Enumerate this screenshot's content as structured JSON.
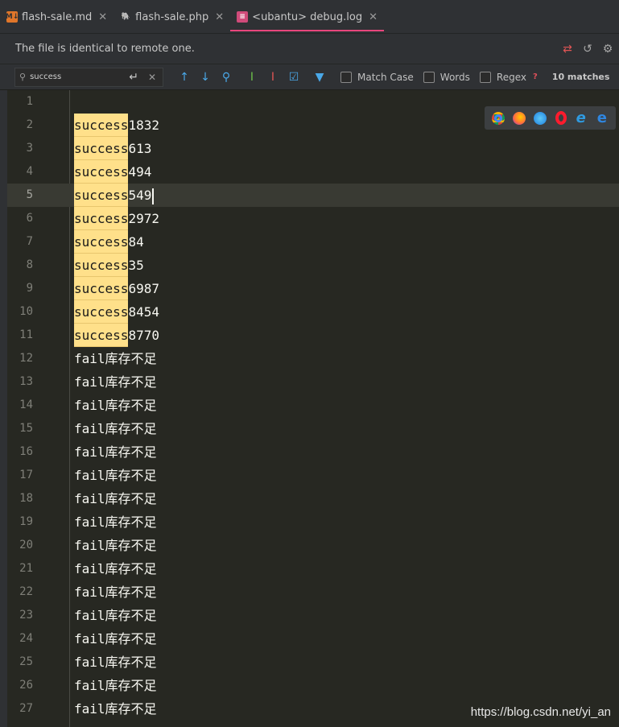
{
  "tabs": [
    {
      "label": "flash-sale.md",
      "icon": "markdown-file-icon",
      "active": false
    },
    {
      "label": "flash-sale.php",
      "icon": "php-file-icon",
      "active": false
    },
    {
      "label": "<ubantu> debug.log",
      "icon": "log-file-icon",
      "active": true
    }
  ],
  "notice": {
    "text": "The file is identical to remote one."
  },
  "search": {
    "query": "success",
    "options": {
      "match_case": "Match Case",
      "words": "Words",
      "regex": "Regex"
    },
    "help": "?",
    "matches": "10 matches"
  },
  "editor": {
    "current_line": 5,
    "lines": [
      {
        "n": "1",
        "match": "",
        "rest": ""
      },
      {
        "n": "2",
        "match": "success",
        "rest": "1832"
      },
      {
        "n": "3",
        "match": "success",
        "rest": "613"
      },
      {
        "n": "4",
        "match": "success",
        "rest": "494"
      },
      {
        "n": "5",
        "match": "success",
        "rest": "549"
      },
      {
        "n": "6",
        "match": "success",
        "rest": "2972"
      },
      {
        "n": "7",
        "match": "success",
        "rest": "84"
      },
      {
        "n": "8",
        "match": "success",
        "rest": "35"
      },
      {
        "n": "9",
        "match": "success",
        "rest": "6987"
      },
      {
        "n": "10",
        "match": "success",
        "rest": "8454"
      },
      {
        "n": "11",
        "match": "success",
        "rest": "8770"
      },
      {
        "n": "12",
        "match": "",
        "rest": "fail库存不足"
      },
      {
        "n": "13",
        "match": "",
        "rest": "fail库存不足"
      },
      {
        "n": "14",
        "match": "",
        "rest": "fail库存不足"
      },
      {
        "n": "15",
        "match": "",
        "rest": "fail库存不足"
      },
      {
        "n": "16",
        "match": "",
        "rest": "fail库存不足"
      },
      {
        "n": "17",
        "match": "",
        "rest": "fail库存不足"
      },
      {
        "n": "18",
        "match": "",
        "rest": "fail库存不足"
      },
      {
        "n": "19",
        "match": "",
        "rest": "fail库存不足"
      },
      {
        "n": "20",
        "match": "",
        "rest": "fail库存不足"
      },
      {
        "n": "21",
        "match": "",
        "rest": "fail库存不足"
      },
      {
        "n": "22",
        "match": "",
        "rest": "fail库存不足"
      },
      {
        "n": "23",
        "match": "",
        "rest": "fail库存不足"
      },
      {
        "n": "24",
        "match": "",
        "rest": "fail库存不足"
      },
      {
        "n": "25",
        "match": "",
        "rest": "fail库存不足"
      },
      {
        "n": "26",
        "match": "",
        "rest": "fail库存不足"
      },
      {
        "n": "27",
        "match": "",
        "rest": "fail库存不足"
      }
    ]
  },
  "watermark": "https://blog.csdn.net/yi_an",
  "colors": {
    "match_highlight": "#ffe08a",
    "active_tab_underline": "#e8467c",
    "editor_bg": "#272822"
  }
}
